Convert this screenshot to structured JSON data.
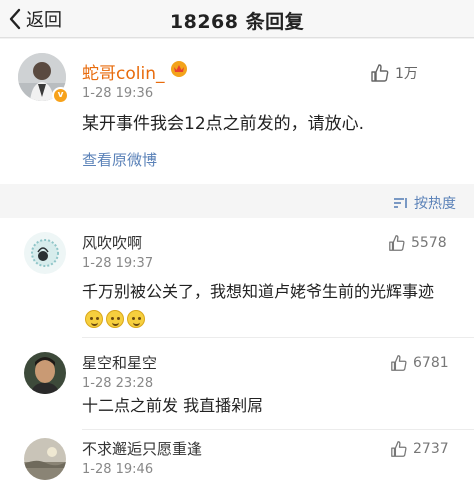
{
  "nav": {
    "back_label": "返回",
    "title": "18268 条回复"
  },
  "post": {
    "author": "蛇哥colin_",
    "time": "1-28 19:36",
    "likes": "1万",
    "text": "某开事件我会12点之前发的，请放心.",
    "view_original": "查看原微博",
    "verified_badge": "v"
  },
  "sort": {
    "label": "按热度"
  },
  "comments": [
    {
      "author": "风吹吹啊",
      "time": "1-28 19:37",
      "likes": "5578",
      "text": "千万别被公关了，我想知道卢姥爷生前的光辉事迹",
      "emoji_count": 3
    },
    {
      "author": "星空和星空",
      "time": "1-28 23:28",
      "likes": "6781",
      "text": "十二点之前发 我直播剁屌"
    },
    {
      "author": "不求邂逅只愿重逢",
      "time": "1-28 19:46",
      "likes": "2737"
    }
  ],
  "colors": {
    "author_orange": "#e86b0c",
    "link_blue": "#5b82b8",
    "badge_orange": "#f7a21b"
  },
  "icons": [
    "back-chevron-icon",
    "vip-crown-icon",
    "thumbs-up-icon",
    "sort-icon",
    "verified-badge-icon",
    "smile-emoji-icon"
  ]
}
